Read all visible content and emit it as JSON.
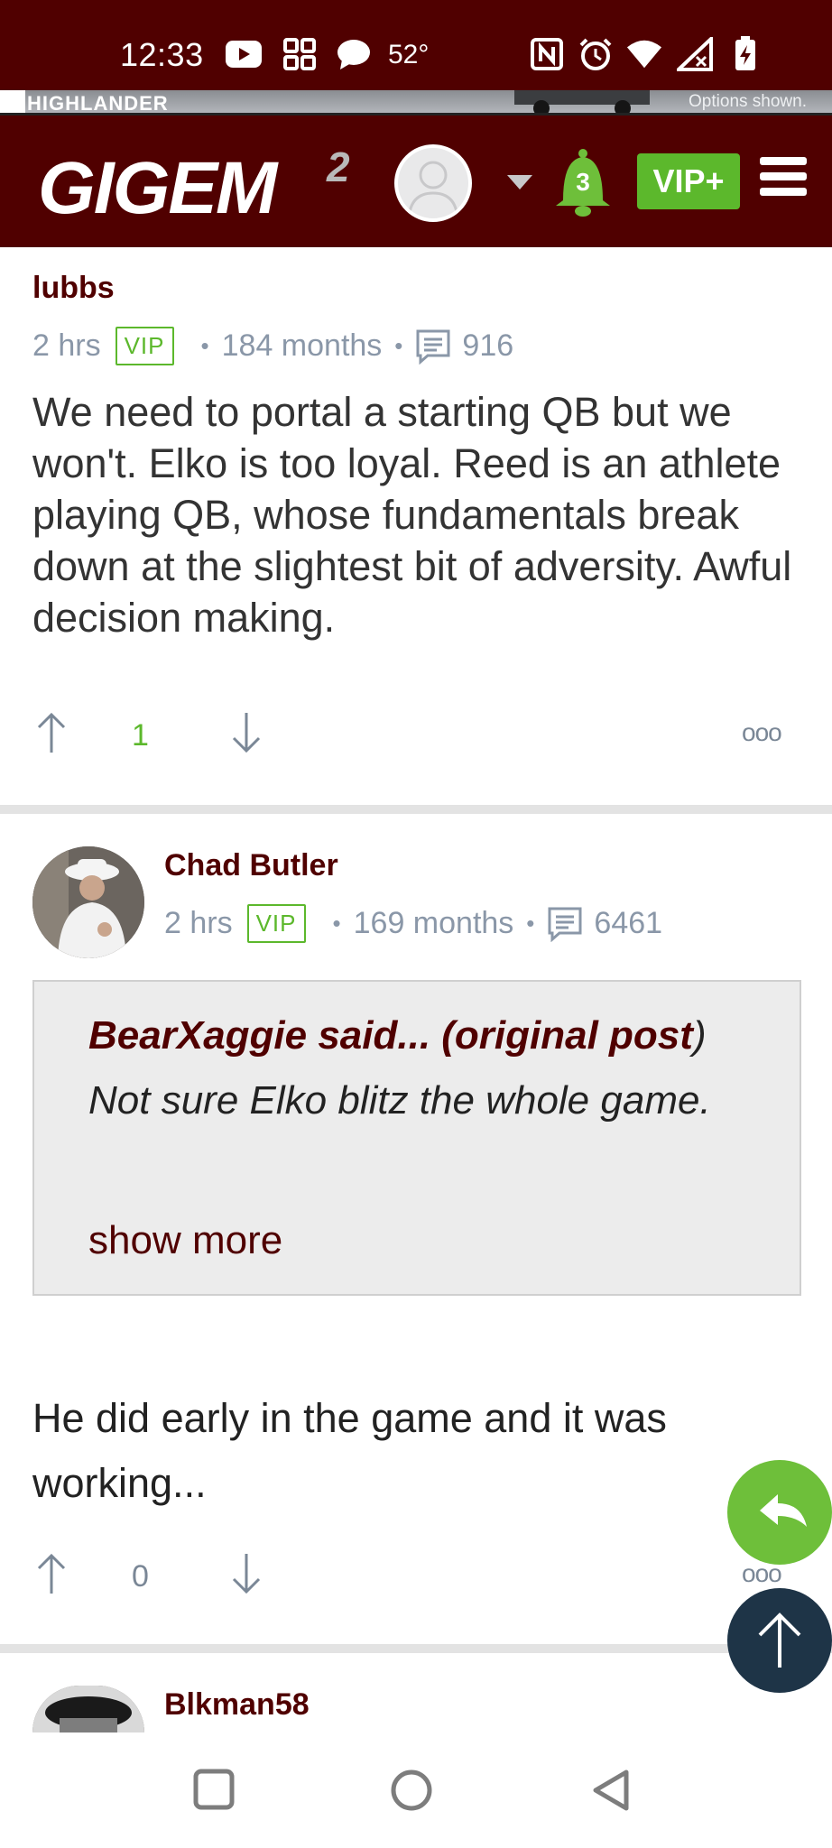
{
  "status_bar": {
    "time": "12:33",
    "temperature": "52°"
  },
  "ad": {
    "brand": "HIGHLANDER",
    "note": "Options shown."
  },
  "header": {
    "logo": "GIGEM",
    "logo_sup": "2",
    "notifications": "3",
    "vip_label": "VIP+"
  },
  "posts": [
    {
      "author": "lubbs",
      "time": "2 hrs",
      "badge": "VIP",
      "tenure": "184 months",
      "post_count": "916",
      "body": "We need to portal a starting QB but we won't. Elko is too loyal. Reed is an athlete playing QB, whose fundamentals break down at the slightest bit of adversity. Awful decision making.",
      "votes": "1"
    },
    {
      "author": "Chad Butler",
      "time": "2 hrs",
      "badge": "VIP",
      "tenure": "169 months",
      "post_count": "6461",
      "quote_author": "BearXaggie said... (original post",
      "quote_text": ") Not sure Elko blitz the whole game.",
      "show_more": "show more",
      "body": "He did early in the game and it was working...",
      "votes": "0"
    },
    {
      "author": "Blkman58"
    }
  ],
  "colors": {
    "maroon": "#500000",
    "vip_green": "#5cb82c",
    "meta_gray": "#8a97a8"
  }
}
